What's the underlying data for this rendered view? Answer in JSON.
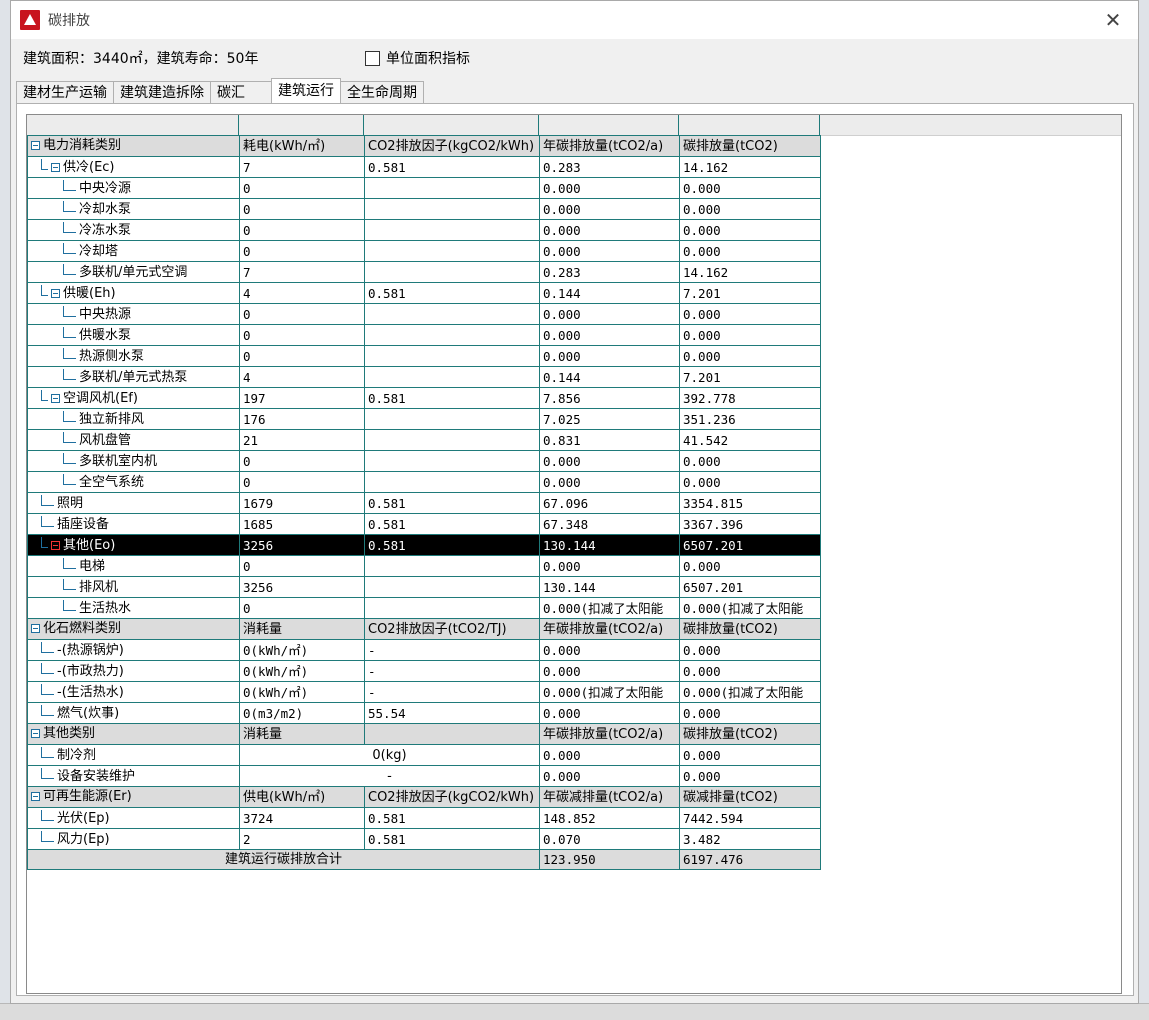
{
  "window": {
    "title": "碳排放"
  },
  "info": {
    "summary": "建筑面积：3440㎡，建筑寿命：50年",
    "checkbox_label": "单位面积指标"
  },
  "tabs": [
    {
      "label": "建材生产运输"
    },
    {
      "label": "建筑建造拆除"
    },
    {
      "label": "碳汇"
    },
    {
      "label": "建筑运行",
      "active": true
    },
    {
      "label": "全生命周期"
    }
  ],
  "table": {
    "rows": [
      {
        "type": "section",
        "level": 0,
        "expander": true,
        "cells": [
          "电力消耗类别",
          "耗电(kWh/㎡)",
          "CO2排放因子(kgCO2/kWh)",
          "年碳排放量(tCO2/a)",
          "碳排放量(tCO2)"
        ]
      },
      {
        "type": "row",
        "level": 1,
        "expander": true,
        "cells": [
          "供冷(Ec)",
          "7",
          "0.581",
          "0.283",
          "14.162"
        ]
      },
      {
        "type": "row",
        "level": 2,
        "cells": [
          "中央冷源",
          "0",
          "",
          "0.000",
          "0.000"
        ]
      },
      {
        "type": "row",
        "level": 2,
        "cells": [
          "冷却水泵",
          "0",
          "",
          "0.000",
          "0.000"
        ]
      },
      {
        "type": "row",
        "level": 2,
        "cells": [
          "冷冻水泵",
          "0",
          "",
          "0.000",
          "0.000"
        ]
      },
      {
        "type": "row",
        "level": 2,
        "cells": [
          "冷却塔",
          "0",
          "",
          "0.000",
          "0.000"
        ]
      },
      {
        "type": "row",
        "level": 2,
        "cells": [
          "多联机/单元式空调",
          "7",
          "",
          "0.283",
          "14.162"
        ]
      },
      {
        "type": "row",
        "level": 1,
        "expander": true,
        "cells": [
          "供暖(Eh)",
          "4",
          "0.581",
          "0.144",
          "7.201"
        ]
      },
      {
        "type": "row",
        "level": 2,
        "cells": [
          "中央热源",
          "0",
          "",
          "0.000",
          "0.000"
        ]
      },
      {
        "type": "row",
        "level": 2,
        "cells": [
          "供暖水泵",
          "0",
          "",
          "0.000",
          "0.000"
        ]
      },
      {
        "type": "row",
        "level": 2,
        "cells": [
          "热源侧水泵",
          "0",
          "",
          "0.000",
          "0.000"
        ]
      },
      {
        "type": "row",
        "level": 2,
        "cells": [
          "多联机/单元式热泵",
          "4",
          "",
          "0.144",
          "7.201"
        ]
      },
      {
        "type": "row",
        "level": 1,
        "expander": true,
        "cells": [
          "空调风机(Ef)",
          "197",
          "0.581",
          "7.856",
          "392.778"
        ]
      },
      {
        "type": "row",
        "level": 2,
        "cells": [
          "独立新排风",
          "176",
          "",
          "7.025",
          "351.236"
        ]
      },
      {
        "type": "row",
        "level": 2,
        "cells": [
          "风机盘管",
          "21",
          "",
          "0.831",
          "41.542"
        ]
      },
      {
        "type": "row",
        "level": 2,
        "cells": [
          "多联机室内机",
          "0",
          "",
          "0.000",
          "0.000"
        ]
      },
      {
        "type": "row",
        "level": 2,
        "cells": [
          "全空气系统",
          "0",
          "",
          "0.000",
          "0.000"
        ]
      },
      {
        "type": "row",
        "level": 1,
        "cells": [
          "照明",
          "1679",
          "0.581",
          "67.096",
          "3354.815"
        ]
      },
      {
        "type": "row",
        "level": 1,
        "cells": [
          "插座设备",
          "1685",
          "0.581",
          "67.348",
          "3367.396"
        ]
      },
      {
        "type": "selected",
        "level": 1,
        "expander": true,
        "cells": [
          "其他(Eo)",
          "3256",
          "0.581",
          "130.144",
          "6507.201"
        ]
      },
      {
        "type": "row",
        "level": 2,
        "cells": [
          "电梯",
          "0",
          "",
          "0.000",
          "0.000"
        ]
      },
      {
        "type": "row",
        "level": 2,
        "cells": [
          "排风机",
          "3256",
          "",
          "130.144",
          "6507.201"
        ]
      },
      {
        "type": "row",
        "level": 2,
        "cells": [
          "生活热水",
          "0",
          "",
          "0.000(扣减了太阳能",
          "0.000(扣减了太阳能"
        ]
      },
      {
        "type": "section",
        "level": 0,
        "expander": true,
        "cells": [
          "化石燃料类别",
          "消耗量",
          "CO2排放因子(tCO2/TJ)",
          "年碳排放量(tCO2/a)",
          "碳排放量(tCO2)"
        ]
      },
      {
        "type": "row",
        "level": 1,
        "cells": [
          "-(热源锅炉)",
          "0(kWh/㎡)",
          "-",
          "0.000",
          "0.000"
        ]
      },
      {
        "type": "row",
        "level": 1,
        "cells": [
          "-(市政热力)",
          "0(kWh/㎡)",
          "-",
          "0.000",
          "0.000"
        ]
      },
      {
        "type": "row",
        "level": 1,
        "cells": [
          "-(生活热水)",
          "0(kWh/㎡)",
          "-",
          "0.000(扣减了太阳能",
          "0.000(扣减了太阳能"
        ]
      },
      {
        "type": "row",
        "level": 1,
        "cells": [
          "燃气(炊事)",
          "0(m3/m2)",
          "55.54",
          "0.000",
          "0.000"
        ]
      },
      {
        "type": "section",
        "level": 0,
        "expander": true,
        "cells": [
          "其他类别",
          "消耗量",
          "",
          "年碳排放量(tCO2/a)",
          "碳排放量(tCO2)"
        ]
      },
      {
        "type": "merged",
        "level": 1,
        "cells": [
          "制冷剂",
          "0(kg)",
          "0.000",
          "0.000"
        ]
      },
      {
        "type": "merged",
        "level": 1,
        "cells": [
          "设备安装维护",
          "-",
          "0.000",
          "0.000"
        ]
      },
      {
        "type": "section",
        "level": 0,
        "expander": true,
        "cells": [
          "可再生能源(Er)",
          "供电(kWh/㎡)",
          "CO2排放因子(kgCO2/kWh)",
          "年碳减排量(tCO2/a)",
          "碳减排量(tCO2)"
        ]
      },
      {
        "type": "row",
        "level": 1,
        "cells": [
          "光伏(Ep)",
          "3724",
          "0.581",
          "148.852",
          "7442.594"
        ]
      },
      {
        "type": "row",
        "level": 1,
        "cells": [
          "风力(Ep)",
          "2",
          "0.581",
          "0.070",
          "3.482"
        ]
      },
      {
        "type": "total",
        "cells": [
          "建筑运行碳排放合计",
          "123.950",
          "6197.476"
        ]
      }
    ]
  }
}
